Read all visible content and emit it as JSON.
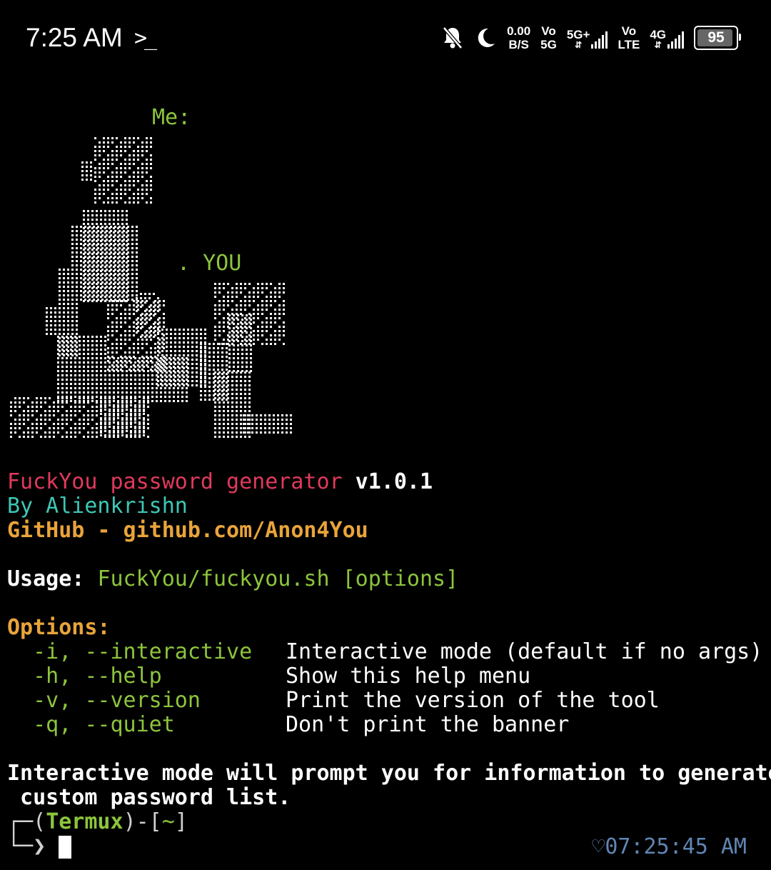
{
  "status_bar": {
    "time": "7:25 AM",
    "terminal_icon": "terminal-prompt-icon",
    "net_speed_top": "0.00",
    "net_speed_bottom": "B/S",
    "sim1_top": "Vo",
    "sim1_bottom": "5G",
    "sim1_type": "5G+",
    "sim2_top": "Vo",
    "sim2_bottom": "LTE",
    "sim2_type": "4G",
    "battery_level": "95",
    "battery_fraction": 0.95,
    "icons": [
      "bell-muted-icon",
      "moon-icon",
      "signal-icon",
      "battery-icon"
    ]
  },
  "banner": {
    "me_label": "Me:",
    "you_label": ". YOU"
  },
  "terminal": {
    "title_app": "FuckYou password generator",
    "title_version": "v1.0.1",
    "author": "By Alienkrishn",
    "github": "GitHub - github.com/Anon4You",
    "usage_label": "Usage:",
    "usage_cmd": "FuckYou/fuckyou.sh [options]",
    "options_label": "Options:",
    "options": [
      {
        "flag": "  -i, --interactive",
        "desc": "Interactive mode (default if no args)"
      },
      {
        "flag": "  -h, --help",
        "desc": "Show this help menu"
      },
      {
        "flag": "  -v, --version",
        "desc": "Print the version of the tool"
      },
      {
        "flag": "  -q, --quiet",
        "desc": "Don't print the banner"
      }
    ],
    "note_line1": "Interactive mode will prompt you for information to generate a",
    "note_line2": " custom password list.",
    "prompt_open": "┌─(",
    "prompt_host": "Termux",
    "prompt_mid": ")-[",
    "prompt_dir": "~",
    "prompt_close": "]",
    "prompt_arrow": "└─❯",
    "clock": "07:25:45 AM",
    "colors": {
      "green": "#8cc43c",
      "teal": "#3ec7b4",
      "orange": "#e9a43a",
      "red": "#e03a5c",
      "blue": "#5f86b4"
    }
  }
}
